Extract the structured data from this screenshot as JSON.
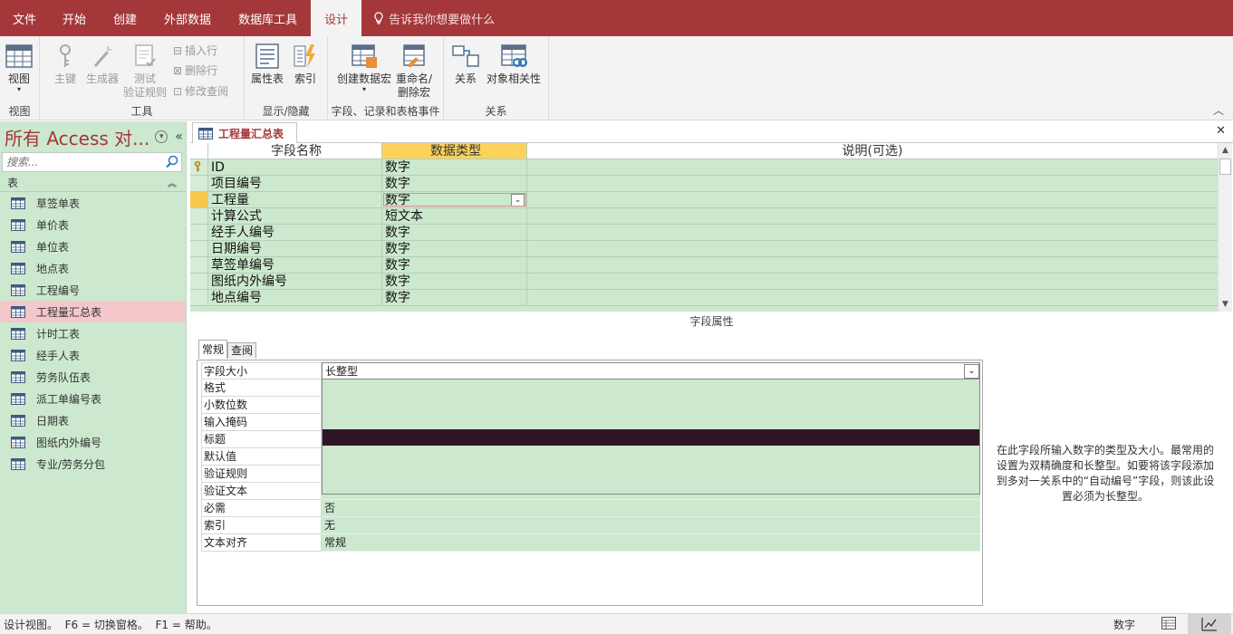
{
  "ribbon_tabs": [
    "文件",
    "开始",
    "创建",
    "外部数据",
    "数据库工具",
    "设计"
  ],
  "active_tab": "设计",
  "tell_me": "告诉我你想要做什么",
  "groups": {
    "views": {
      "label": "视图",
      "view_btn": "视图"
    },
    "tools": {
      "label": "工具",
      "primary_key": "主键",
      "builder": "生成器",
      "test_rules_1": "测试",
      "test_rules_2": "验证规则",
      "insert_rows": "插入行",
      "delete_rows": "删除行",
      "modify_lookup": "修改查阅"
    },
    "show_hide": {
      "label": "显示/隐藏",
      "property_sheet": "属性表",
      "indexes": "索引"
    },
    "events": {
      "label": "字段、记录和表格事件",
      "create_macro": "创建数据宏",
      "rename_macro_1": "重命名/",
      "rename_macro_2": "删除宏"
    },
    "relationships": {
      "label": "关系",
      "relationships": "关系",
      "object_dependencies": "对象相关性"
    }
  },
  "nav": {
    "title": "所有 Access 对...",
    "search_placeholder": "搜索...",
    "section": "表",
    "items": [
      "草签单表",
      "单价表",
      "单位表",
      "地点表",
      "工程编号",
      "工程量汇总表",
      "计时工表",
      "经手人表",
      "劳务队伍表",
      "派工单编号表",
      "日期表",
      "图纸内外编号",
      "专业/劳务分包"
    ],
    "selected": "工程量汇总表"
  },
  "document": {
    "tab_title": "工程量汇总表",
    "columns": {
      "name": "字段名称",
      "type": "数据类型",
      "desc": "说明(可选)"
    },
    "fields": [
      {
        "name": "ID",
        "type": "数字"
      },
      {
        "name": "项目编号",
        "type": "数字"
      },
      {
        "name": "工程量",
        "type": "数字"
      },
      {
        "name": "计算公式",
        "type": "短文本"
      },
      {
        "name": "经手人编号",
        "type": "数字"
      },
      {
        "name": "日期编号",
        "type": "数字"
      },
      {
        "name": "草签单编号",
        "type": "数字"
      },
      {
        "name": "图纸内外编号",
        "type": "数字"
      },
      {
        "name": "地点编号",
        "type": "数字"
      }
    ],
    "current_field": "工程量",
    "primary_key_field": "ID"
  },
  "properties": {
    "label": "字段属性",
    "tabs": [
      "常规",
      "查阅"
    ],
    "rows": [
      {
        "name": "字段大小",
        "value": "长整型"
      },
      {
        "name": "格式",
        "value": ""
      },
      {
        "name": "小数位数",
        "value": ""
      },
      {
        "name": "输入掩码",
        "value": ""
      },
      {
        "name": "标题",
        "value": ""
      },
      {
        "name": "默认值",
        "value": ""
      },
      {
        "name": "验证规则",
        "value": ""
      },
      {
        "name": "验证文本",
        "value": ""
      },
      {
        "name": "必需",
        "value": "否"
      },
      {
        "name": "索引",
        "value": "无"
      },
      {
        "name": "文本对齐",
        "value": "常规"
      }
    ],
    "hint": "在此字段所输入数字的类型及大小。最常用的设置为双精确度和长整型。如要将该字段添加到多对一关系中的“自动编号”字段，则该此设置必须为长整型。"
  },
  "status": {
    "left": "设计视图。  F6 = 切换窗格。  F1 = 帮助。",
    "mode": "数字"
  },
  "colors": {
    "brand": "#a4373a",
    "grid_bg": "#cce8cf",
    "header_type": "#fcd25b"
  }
}
